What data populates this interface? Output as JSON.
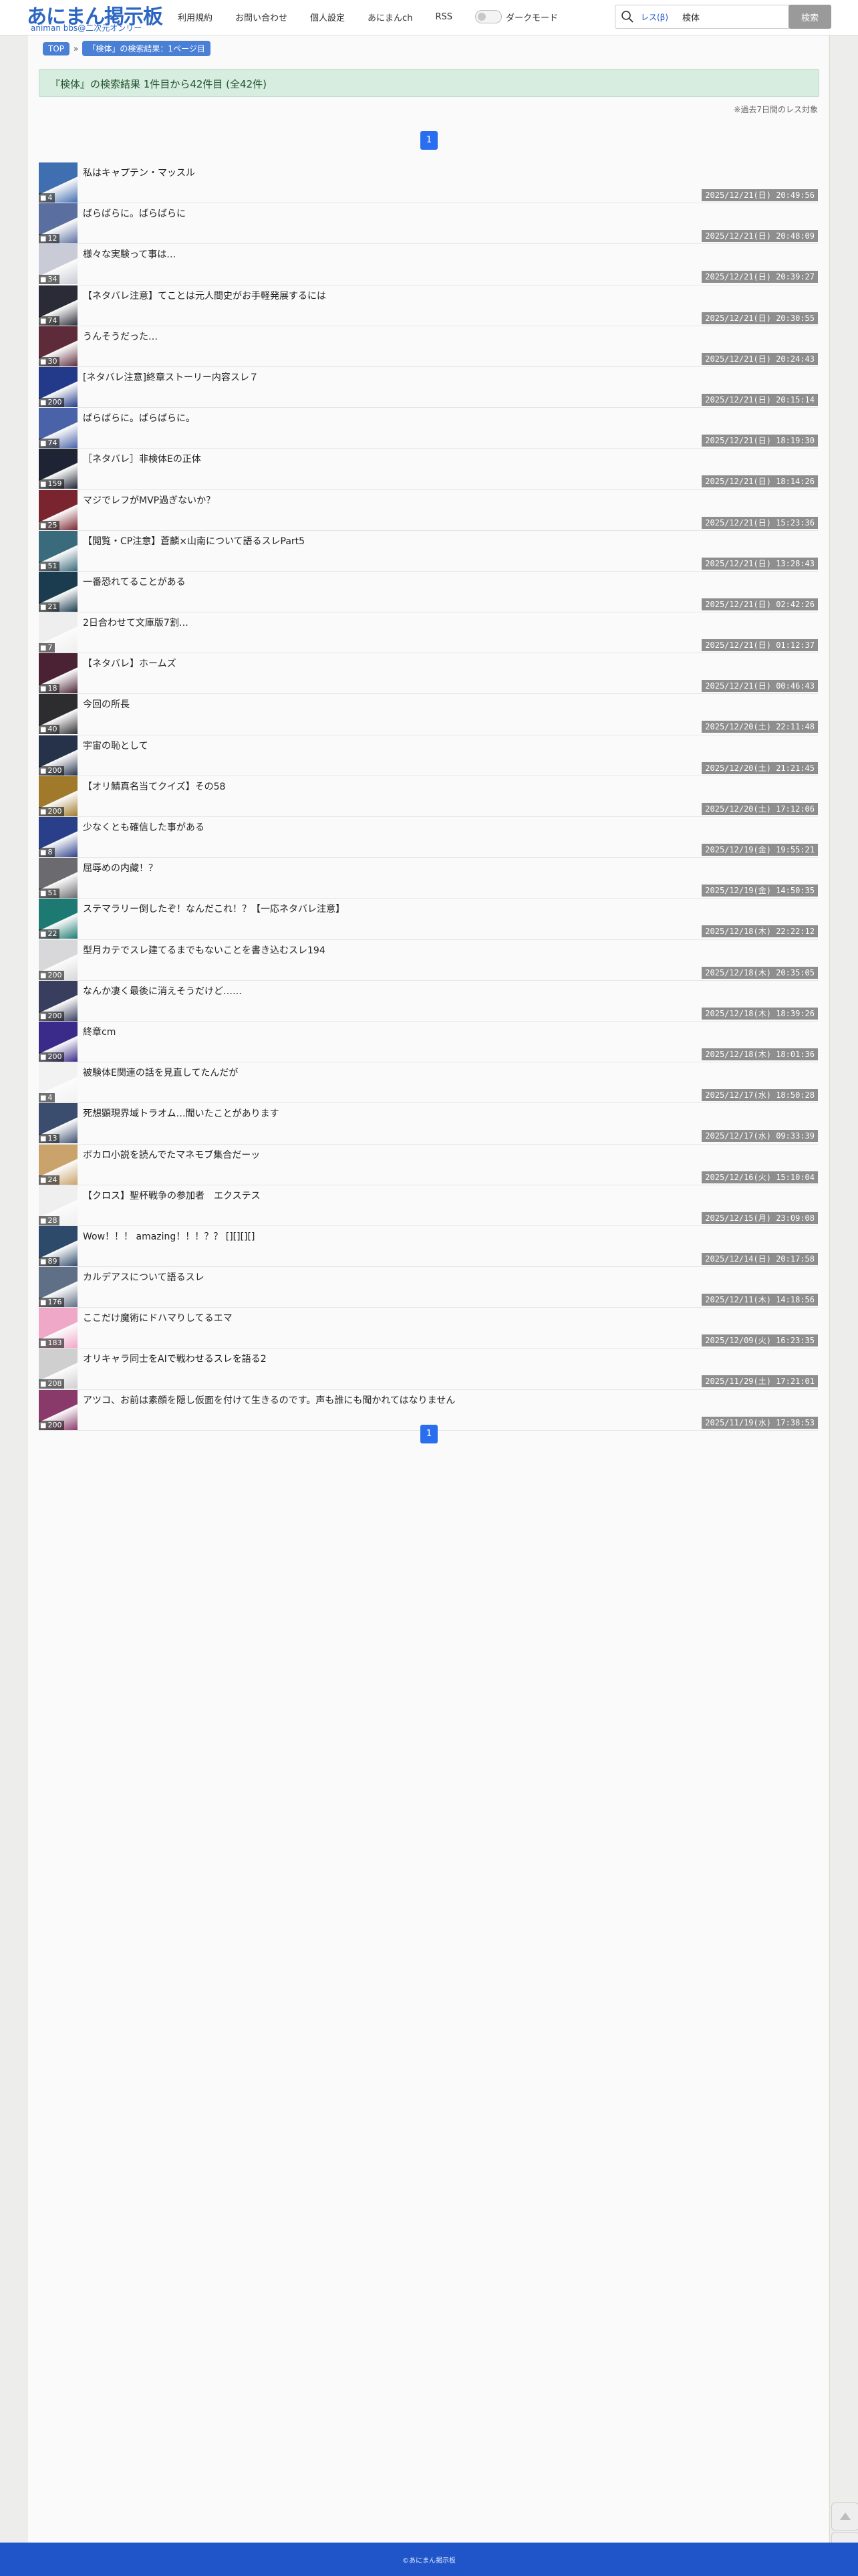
{
  "header": {
    "logo_main": "あにまん掲示板",
    "logo_sub": "animan bbs@二次元オンリー",
    "nav": [
      "利用規約",
      "お問い合わせ",
      "個人設定",
      "あにまんch",
      "RSS"
    ],
    "dark_mode_label": "ダークモード",
    "search_scope": "レス(β)",
    "search_value": "検体",
    "search_button": "検索"
  },
  "breadcrumb": {
    "top": "TOP",
    "sep": "»",
    "current": "「検体」の検索結果：1ページ目"
  },
  "result_banner": "『検体』の検索結果 1件目から42件目 (全42件)",
  "note": "※過去7日間のレス対象",
  "pager": {
    "page": "1"
  },
  "threads": [
    {
      "title": "私はキャプテン・マッスル",
      "count": "4",
      "date": "2025/12/21(日) 20:49:56",
      "thumb": "#3f6fb0"
    },
    {
      "title": "ばらばらに。ばらばらに",
      "count": "12",
      "date": "2025/12/21(日) 20:48:09",
      "thumb": "#5a6fa0"
    },
    {
      "title": "様々な実験って事は…",
      "count": "34",
      "date": "2025/12/21(日) 20:39:27",
      "thumb": "#c9cbd6"
    },
    {
      "title": "【ネタバレ注意】てことは元人間史がお手軽発展するには",
      "count": "74",
      "date": "2025/12/21(日) 20:30:55",
      "thumb": "#2b2b38"
    },
    {
      "title": "うんそうだった…",
      "count": "30",
      "date": "2025/12/21(日) 20:24:43",
      "thumb": "#5e2b3b"
    },
    {
      "title": "[ネタバレ注意]終章ストーリー内容スレ７",
      "count": "200",
      "date": "2025/12/21(日) 20:15:14",
      "thumb": "#233a8a"
    },
    {
      "title": "ばらばらに。ばらばらに。",
      "count": "74",
      "date": "2025/12/21(日) 18:19:30",
      "thumb": "#4a63a8"
    },
    {
      "title": "［ネタバレ］非検体Eの正体",
      "count": "159",
      "date": "2025/12/21(日) 18:14:26",
      "thumb": "#1e2433"
    },
    {
      "title": "マジでレフがMVP過ぎないか？",
      "count": "25",
      "date": "2025/12/21(日) 15:23:36",
      "thumb": "#7a2430"
    },
    {
      "title": "【閲覧・CP注意】蒼麟×山南について語るスレPart5",
      "count": "51",
      "date": "2025/12/21(日) 13:28:43",
      "thumb": "#3a6b7d"
    },
    {
      "title": "一番恐れてることがある",
      "count": "21",
      "date": "2025/12/21(日) 02:42:26",
      "thumb": "#1b3c4e"
    },
    {
      "title": "2日合わせて文庫版7割…",
      "count": "7",
      "date": "2025/12/21(日) 01:12:37",
      "thumb": "#eeeeee"
    },
    {
      "title": "【ネタバレ】ホームズ",
      "count": "18",
      "date": "2025/12/21(日) 00:46:43",
      "thumb": "#4a2233"
    },
    {
      "title": "今回の所長",
      "count": "40",
      "date": "2025/12/20(土) 22:11:48",
      "thumb": "#2d2d30"
    },
    {
      "title": "宇宙の恥として",
      "count": "200",
      "date": "2025/12/20(土) 21:21:45",
      "thumb": "#26324a"
    },
    {
      "title": "【オリ鯖真名当てクイズ】その58",
      "count": "200",
      "date": "2025/12/20(土) 17:12:06",
      "thumb": "#a07a2a"
    },
    {
      "title": "少なくとも確信した事がある",
      "count": "8",
      "date": "2025/12/19(金) 19:55:21",
      "thumb": "#2a3f8a"
    },
    {
      "title": "屈辱めの内藏！？",
      "count": "51",
      "date": "2025/12/19(金) 14:50:35",
      "thumb": "#6b6a6e"
    },
    {
      "title": "ステマラリー倒したぞ！なんだこれ！？【一応ネタバレ注意】",
      "count": "22",
      "date": "2025/12/18(木) 22:22:12",
      "thumb": "#1d7a72"
    },
    {
      "title": "型月カテでスレ建てるまでもないことを書き込むスレ194",
      "count": "200",
      "date": "2025/12/18(木) 20:35:05",
      "thumb": "#d8d8da"
    },
    {
      "title": "なんか凄く最後に消えそうだけど……",
      "count": "200",
      "date": "2025/12/18(木) 18:39:26",
      "thumb": "#3a3e5e"
    },
    {
      "title": "終章cm",
      "count": "200",
      "date": "2025/12/18(木) 18:01:36",
      "thumb": "#3a2a8a"
    },
    {
      "title": "被験体E関連の話を見直してたんだが",
      "count": "4",
      "date": "2025/12/17(水) 18:50:28",
      "thumb": "#f2f2f2"
    },
    {
      "title": "死想顕現界域トラオム…聞いたことがあります",
      "count": "13",
      "date": "2025/12/17(水) 09:33:39",
      "thumb": "#3b4d6e"
    },
    {
      "title": "ボカロ小説を読んでたマネモブ集合だーッ",
      "count": "24",
      "date": "2025/12/16(火) 15:10:04",
      "thumb": "#c9a36b"
    },
    {
      "title": "【クロス】聖杯戦争の参加者　エクステス",
      "count": "28",
      "date": "2025/12/15(月) 23:09:08",
      "thumb": "#efefef"
    },
    {
      "title": "Wow！！！ amazing！！！？？ [][][][]",
      "count": "89",
      "date": "2025/12/14(日) 20:17:58",
      "thumb": "#2e4a6a"
    },
    {
      "title": "カルデアスについて語るスレ",
      "count": "176",
      "date": "2025/12/11(木) 14:18:56",
      "thumb": "#5e6f86"
    },
    {
      "title": "ここだけ魔術にドハマりしてるエマ",
      "count": "183",
      "date": "2025/12/09(火) 16:23:35",
      "thumb": "#f0a8c8"
    },
    {
      "title": "オリキャラ同士をAIで戦わせるスレを語る2",
      "count": "208",
      "date": "2025/11/29(土) 17:21:01",
      "thumb": "#cfcfcf"
    },
    {
      "title": "アツコ、お前は素顔を隠し仮面を付けて生きるのです。声も誰にも聞かれてはなりません",
      "count": "200",
      "date": "2025/11/19(水) 17:38:53",
      "thumb": "#8a3a6a"
    }
  ],
  "footer": "©あにまん掲示板"
}
